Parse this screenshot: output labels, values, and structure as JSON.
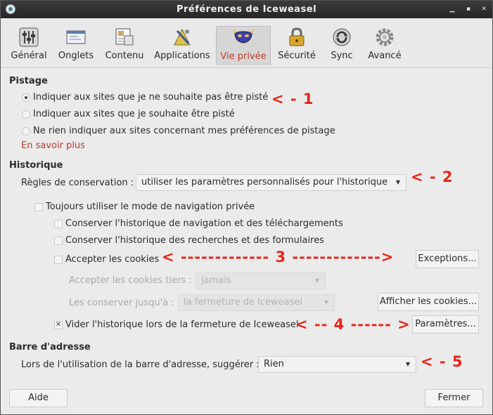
{
  "window": {
    "title": "Préférences de Iceweasel",
    "controls": {
      "minimize": "▁",
      "maximize": "▪",
      "close": "✕"
    }
  },
  "toolbar": {
    "items": [
      {
        "label": "Général",
        "icon": "sliders-icon"
      },
      {
        "label": "Onglets",
        "icon": "tabs-icon"
      },
      {
        "label": "Contenu",
        "icon": "content-icon"
      },
      {
        "label": "Applications",
        "icon": "applications-icon"
      },
      {
        "label": "Vie privée",
        "icon": "mask-icon",
        "active": true
      },
      {
        "label": "Sécurité",
        "icon": "lock-icon"
      },
      {
        "label": "Sync",
        "icon": "sync-icon"
      },
      {
        "label": "Avancé",
        "icon": "gear-icon"
      }
    ]
  },
  "tracking": {
    "title": "Pistage",
    "options": [
      {
        "label": "Indiquer aux sites que je ne souhaite pas être pisté",
        "selected": true
      },
      {
        "label": "Indiquer aux sites que je souhaite être pisté",
        "selected": false
      },
      {
        "label": "Ne rien indiquer aux sites concernant mes préférences de pistage",
        "selected": false
      }
    ],
    "learn_more": "En savoir plus"
  },
  "history": {
    "title": "Historique",
    "rules_label": "Règles de conservation :",
    "rules_value": "utiliser les paramètres personnalisés pour l'historique",
    "private_mode": "Toujours utiliser le mode de navigation privée",
    "keep_browsing": "Conserver l'historique de navigation et des téléchargements",
    "keep_search": "Conserver l'historique des recherches et des formulaires",
    "accept_cookies": "Accepter les cookies",
    "exceptions_button": "Exceptions...",
    "third_party_label": "Accepter les cookies tiers :",
    "third_party_value": "jamais",
    "keep_until_label": "Les conserver jusqu'à :",
    "keep_until_value": "la fermeture de Iceweasel",
    "show_cookies_button": "Afficher les cookies...",
    "clear_on_close": "Vider l'historique lors de la fermeture de Iceweasel",
    "clear_on_close_checked": true,
    "settings_button": "Paramètres..."
  },
  "address_bar": {
    "title": "Barre d'adresse",
    "suggest_label": "Lors de l'utilisation de la barre d'adresse, suggérer :",
    "suggest_value": "Rien"
  },
  "annotations": {
    "a1": "< - 1",
    "a2": "< - 2",
    "a3": "< ------------- 3 ------------->",
    "a4": "< -- 4 ------ >",
    "a5": "< - 5"
  },
  "footer": {
    "help_button": "Aide",
    "close_button": "Fermer"
  },
  "colors": {
    "accent_red": "#c0392b",
    "annotation_red": "#e8251a",
    "titlebar": "#2f2f2f"
  }
}
